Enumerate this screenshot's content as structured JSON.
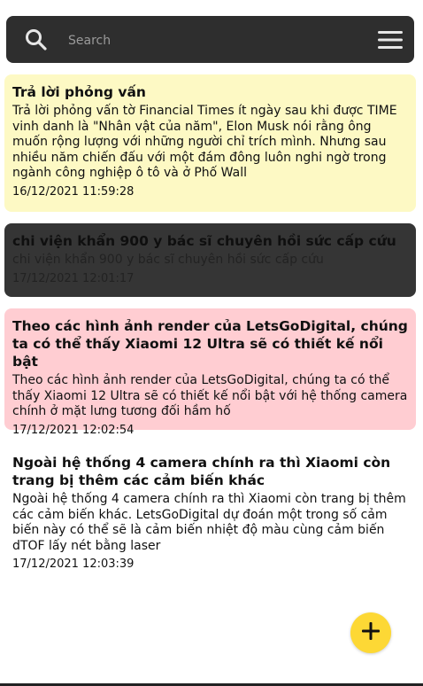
{
  "search": {
    "placeholder": "Search",
    "search_icon": "search-icon",
    "menu_icon": "menu-icon"
  },
  "notes": [
    {
      "title": "Trả lời phỏng vấn",
      "body": "Trả lời phỏng vấn tờ Financial Times ít ngày sau khi được TIME vinh danh là \"Nhân vật của năm\", Elon Musk nói rằng ông muốn rộng lượng với những người chỉ trích mình. Nhưng sau nhiều năm chiến đấu với một đám đông luôn nghi ngờ trong ngành công nghiệp ô tô và ở Phố Wall",
      "date": "16/12/2021 11:59:28",
      "color": "#fdf9c4"
    },
    {
      "title": "chi viện khẩn 900 y bác sĩ chuyên hồi sức cấp cứu",
      "body": "chi viện khẩn 900 y bác sĩ chuyên hồi sức cấp cứu",
      "date": "17/12/2021 12:01:17",
      "color": "#353535"
    },
    {
      "title": "Theo các hình ảnh render của LetsGoDigital, chúng ta có thể thấy Xiaomi 12 Ultra sẽ có thiết kế nổi bật",
      "body": "Theo các hình ảnh render của LetsGoDigital, chúng ta có thể thấy Xiaomi 12 Ultra sẽ có thiết kế nổi bật với hệ thống camera chính ở mặt lưng tương đối hầm hố",
      "date": "17/12/2021 12:02:54",
      "color": "#ffcdd2"
    },
    {
      "title": "Ngoài hệ thống 4 camera chính ra thì Xiaomi còn trang bị thêm các cảm biến khác",
      "body": "Ngoài hệ thống 4 camera chính ra thì Xiaomi còn trang bị thêm các cảm biến khác. LetsGoDigital dự đoán một trong số cảm biến này có thể sẽ là cảm biến nhiệt độ màu cùng cảm biến dTOF lấy nét bằng laser",
      "date": "17/12/2021 12:03:39",
      "color": "#ffffff"
    }
  ],
  "fab": {
    "icon": "plus-icon",
    "color": "#fdd835"
  }
}
